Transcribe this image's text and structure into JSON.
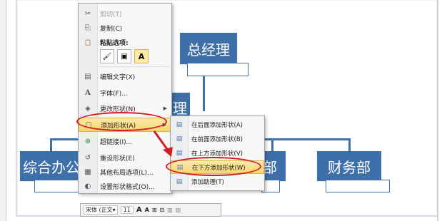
{
  "org_chart": {
    "top": "总经理",
    "middle_partial": "理",
    "left": "综合办公",
    "right_partial": "部",
    "finance": "财务部"
  },
  "context_menu": {
    "items": [
      {
        "icon": "scissors-icon",
        "glyph": "✂",
        "label": "剪切(T)",
        "disabled": true
      },
      {
        "icon": "copy-icon",
        "glyph": "⎘",
        "label": "复制(C)"
      },
      {
        "icon": "paste-icon",
        "glyph": "📋",
        "label": "粘贴选项:"
      },
      {
        "icon": "edit-text-icon",
        "glyph": "▤",
        "label": "编辑文字(X)"
      },
      {
        "icon": "font-icon",
        "glyph": "A",
        "label": "字体(F)..."
      },
      {
        "icon": "change-shape-icon",
        "glyph": "◈",
        "label": "更改形状(N)",
        "submenu": true
      },
      {
        "icon": "add-shape-icon",
        "glyph": "▢",
        "label": "添加形状(A)",
        "submenu": true,
        "highlighted": true
      },
      {
        "icon": "hyperlink-icon",
        "glyph": "⊛",
        "label": "超链接(I)..."
      },
      {
        "icon": "reset-shape-icon",
        "glyph": "↺",
        "label": "重设形状(E)"
      },
      {
        "icon": "layout-icon",
        "glyph": "▦",
        "label": "其他布局选项(L)..."
      },
      {
        "icon": "format-shape-icon",
        "glyph": "◐",
        "label": "设置形状格式(O)..."
      }
    ],
    "paste_options": [
      "🖌",
      "▣",
      "A"
    ]
  },
  "submenu": {
    "items": [
      {
        "icon": "add-after-icon",
        "glyph": "▤",
        "label": "在后面添加形状(A)"
      },
      {
        "icon": "add-before-icon",
        "glyph": "▤",
        "label": "在前面添加形状(B)"
      },
      {
        "icon": "add-above-icon",
        "glyph": "▤",
        "label": "在上方添加形状(V)"
      },
      {
        "icon": "add-below-icon",
        "glyph": "▤",
        "label": "在下方添加形状(W)",
        "highlighted": true
      },
      {
        "icon": "add-assistant-icon",
        "glyph": "▤",
        "label": "添加助理(T)"
      }
    ]
  },
  "mini_toolbar": {
    "font": "宋体 (正文▾",
    "size": "11",
    "buttons": [
      "A",
      "A",
      "⊞",
      "⊟",
      "▥",
      "▥"
    ]
  },
  "colors": {
    "node": "#3f6fa8",
    "highlight": "#f8d66d",
    "annotation": "#d11f1f"
  }
}
